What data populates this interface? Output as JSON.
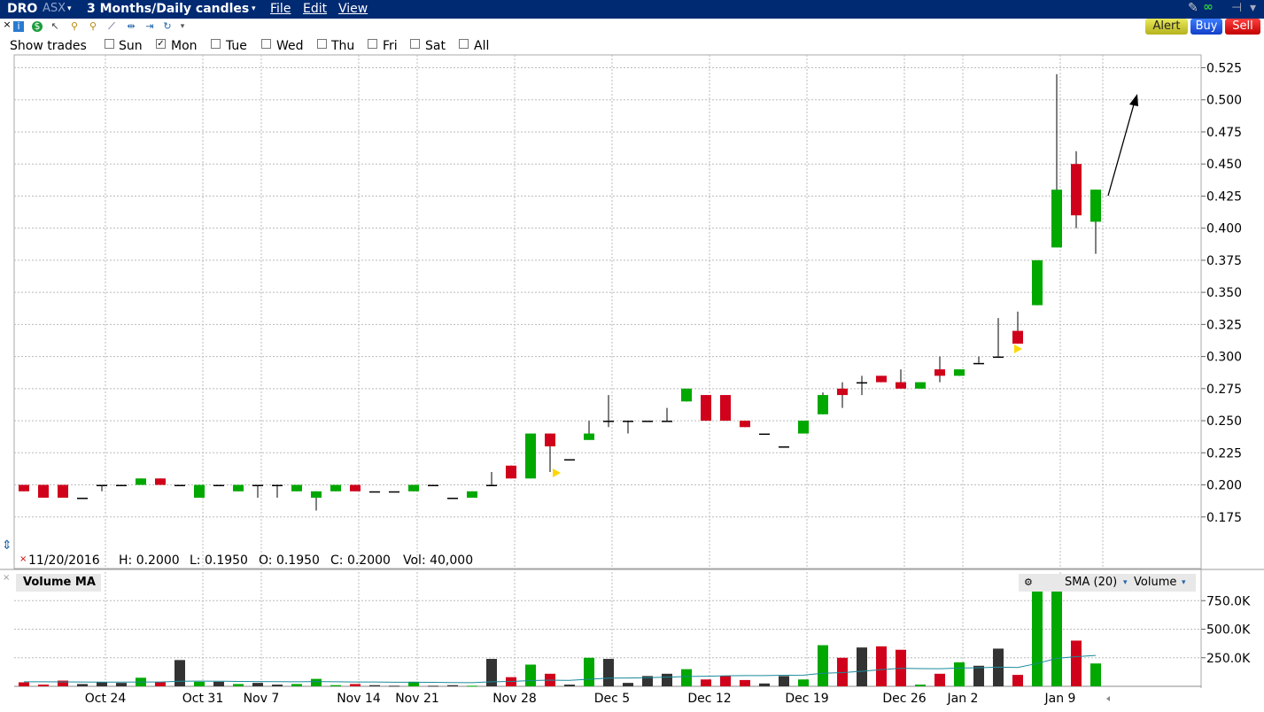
{
  "header": {
    "symbol": "DRO",
    "exchange": "ASX",
    "timeframe": "3 Months/Daily candles",
    "menu": [
      "File",
      "Edit",
      "View"
    ]
  },
  "buttons": {
    "alert": "Alert",
    "buy": "Buy",
    "sell": "Sell"
  },
  "colors": {
    "up": "#00a800",
    "down": "#d0021b",
    "neutral": "#333333",
    "sma": "#1a8a9a",
    "titlebar": "#002a72"
  },
  "show_trades": {
    "label": "Show trades",
    "days": [
      {
        "label": "Sun",
        "checked": false
      },
      {
        "label": "Mon",
        "checked": true
      },
      {
        "label": "Tue",
        "checked": false
      },
      {
        "label": "Wed",
        "checked": false
      },
      {
        "label": "Thu",
        "checked": false
      },
      {
        "label": "Fri",
        "checked": false
      },
      {
        "label": "Sat",
        "checked": false
      },
      {
        "label": "All",
        "checked": false
      }
    ]
  },
  "ohlc": {
    "date": "11/20/2016",
    "h": "H: 0.2000",
    "l": "L: 0.1950",
    "o": "O: 0.1950",
    "c": "C: 0.2000",
    "vol": "Vol: 40,000"
  },
  "volume_panel": {
    "label": "Volume MA",
    "sma": "SMA (20)",
    "volume": "Volume"
  },
  "chart_data": {
    "type": "candlestick",
    "ylim": [
      0.15,
      0.535
    ],
    "yticks": [
      "0.175",
      "0.200",
      "0.225",
      "0.250",
      "0.275",
      "0.300",
      "0.325",
      "0.350",
      "0.375",
      "0.400",
      "0.425",
      "0.450",
      "0.475",
      "0.500",
      "0.525"
    ],
    "yticks_num": [
      0.175,
      0.2,
      0.225,
      0.25,
      0.275,
      0.3,
      0.325,
      0.35,
      0.375,
      0.4,
      0.425,
      0.45,
      0.475,
      0.5,
      0.525
    ],
    "xticks": [
      "Oct 24",
      "Oct 31",
      "Nov 7",
      "Nov 14",
      "Nov 21",
      "Nov 28",
      "Dec 5",
      "Dec 12",
      "Dec 19",
      "Dec 26",
      "Jan 2",
      "Jan 9"
    ],
    "xtick_index": [
      4,
      9,
      12,
      17,
      20,
      25,
      30,
      35,
      40,
      45,
      48,
      53
    ],
    "candles": [
      {
        "o": 0.2,
        "h": 0.2,
        "l": 0.195,
        "c": 0.195
      },
      {
        "o": 0.2,
        "h": 0.2,
        "l": 0.19,
        "c": 0.19
      },
      {
        "o": 0.2,
        "h": 0.2,
        "l": 0.19,
        "c": 0.19
      },
      {
        "o": 0.19,
        "h": 0.19,
        "l": 0.19,
        "c": 0.19
      },
      {
        "o": 0.2,
        "h": 0.2,
        "l": 0.195,
        "c": 0.2
      },
      {
        "o": 0.2,
        "h": 0.2,
        "l": 0.2,
        "c": 0.2
      },
      {
        "o": 0.2,
        "h": 0.205,
        "l": 0.2,
        "c": 0.205
      },
      {
        "o": 0.205,
        "h": 0.205,
        "l": 0.2,
        "c": 0.2
      },
      {
        "o": 0.2,
        "h": 0.2,
        "l": 0.2,
        "c": 0.2
      },
      {
        "o": 0.19,
        "h": 0.2,
        "l": 0.19,
        "c": 0.2
      },
      {
        "o": 0.2,
        "h": 0.2,
        "l": 0.2,
        "c": 0.2
      },
      {
        "o": 0.195,
        "h": 0.2,
        "l": 0.195,
        "c": 0.2
      },
      {
        "o": 0.2,
        "h": 0.2,
        "l": 0.19,
        "c": 0.2
      },
      {
        "o": 0.2,
        "h": 0.2,
        "l": 0.19,
        "c": 0.2
      },
      {
        "o": 0.195,
        "h": 0.2,
        "l": 0.195,
        "c": 0.2
      },
      {
        "o": 0.19,
        "h": 0.195,
        "l": 0.18,
        "c": 0.195
      },
      {
        "o": 0.195,
        "h": 0.2,
        "l": 0.195,
        "c": 0.2
      },
      {
        "o": 0.2,
        "h": 0.2,
        "l": 0.195,
        "c": 0.195
      },
      {
        "o": 0.195,
        "h": 0.195,
        "l": 0.195,
        "c": 0.195
      },
      {
        "o": 0.195,
        "h": 0.195,
        "l": 0.195,
        "c": 0.195
      },
      {
        "o": 0.195,
        "h": 0.2,
        "l": 0.195,
        "c": 0.2
      },
      {
        "o": 0.2,
        "h": 0.2,
        "l": 0.2,
        "c": 0.2
      },
      {
        "o": 0.19,
        "h": 0.19,
        "l": 0.19,
        "c": 0.19
      },
      {
        "o": 0.19,
        "h": 0.195,
        "l": 0.19,
        "c": 0.195
      },
      {
        "o": 0.2,
        "h": 0.21,
        "l": 0.2,
        "c": 0.2
      },
      {
        "o": 0.215,
        "h": 0.215,
        "l": 0.205,
        "c": 0.205
      },
      {
        "o": 0.205,
        "h": 0.24,
        "l": 0.205,
        "c": 0.24
      },
      {
        "o": 0.24,
        "h": 0.24,
        "l": 0.21,
        "c": 0.23
      },
      {
        "o": 0.22,
        "h": 0.22,
        "l": 0.22,
        "c": 0.22
      },
      {
        "o": 0.235,
        "h": 0.25,
        "l": 0.235,
        "c": 0.24
      },
      {
        "o": 0.25,
        "h": 0.27,
        "l": 0.245,
        "c": 0.25
      },
      {
        "o": 0.25,
        "h": 0.25,
        "l": 0.24,
        "c": 0.25
      },
      {
        "o": 0.25,
        "h": 0.25,
        "l": 0.25,
        "c": 0.25
      },
      {
        "o": 0.25,
        "h": 0.26,
        "l": 0.25,
        "c": 0.25
      },
      {
        "o": 0.265,
        "h": 0.275,
        "l": 0.265,
        "c": 0.275
      },
      {
        "o": 0.27,
        "h": 0.27,
        "l": 0.25,
        "c": 0.25
      },
      {
        "o": 0.27,
        "h": 0.27,
        "l": 0.25,
        "c": 0.25
      },
      {
        "o": 0.25,
        "h": 0.25,
        "l": 0.245,
        "c": 0.245
      },
      {
        "o": 0.24,
        "h": 0.24,
        "l": 0.24,
        "c": 0.24
      },
      {
        "o": 0.23,
        "h": 0.23,
        "l": 0.23,
        "c": 0.23
      },
      {
        "o": 0.24,
        "h": 0.25,
        "l": 0.24,
        "c": 0.25
      },
      {
        "o": 0.255,
        "h": 0.272,
        "l": 0.255,
        "c": 0.27
      },
      {
        "o": 0.275,
        "h": 0.28,
        "l": 0.26,
        "c": 0.27
      },
      {
        "o": 0.28,
        "h": 0.285,
        "l": 0.27,
        "c": 0.28
      },
      {
        "o": 0.285,
        "h": 0.285,
        "l": 0.28,
        "c": 0.28
      },
      {
        "o": 0.28,
        "h": 0.29,
        "l": 0.275,
        "c": 0.275
      },
      {
        "o": 0.275,
        "h": 0.28,
        "l": 0.275,
        "c": 0.28
      },
      {
        "o": 0.29,
        "h": 0.3,
        "l": 0.28,
        "c": 0.285
      },
      {
        "o": 0.285,
        "h": 0.29,
        "l": 0.285,
        "c": 0.29
      },
      {
        "o": 0.295,
        "h": 0.3,
        "l": 0.295,
        "c": 0.295
      },
      {
        "o": 0.3,
        "h": 0.33,
        "l": 0.3,
        "c": 0.3
      },
      {
        "o": 0.32,
        "h": 0.335,
        "l": 0.31,
        "c": 0.31
      },
      {
        "o": 0.34,
        "h": 0.375,
        "l": 0.34,
        "c": 0.375
      },
      {
        "o": 0.385,
        "h": 0.52,
        "l": 0.385,
        "c": 0.43
      },
      {
        "o": 0.45,
        "h": 0.46,
        "l": 0.4,
        "c": 0.41
      },
      {
        "o": 0.405,
        "h": 0.43,
        "l": 0.38,
        "c": 0.43
      }
    ],
    "volume_ylim": [
      0,
      1000000
    ],
    "volume_yticks": [
      "250.0K",
      "500.0K",
      "750.0K"
    ],
    "volume_yticks_num": [
      250000,
      500000,
      750000
    ],
    "volume": [
      35000,
      15000,
      50000,
      20000,
      35000,
      30000,
      75000,
      35000,
      230000,
      40000,
      40000,
      20000,
      30000,
      15000,
      20000,
      65000,
      10000,
      20000,
      10000,
      5000,
      40000,
      5000,
      10000,
      5000,
      240000,
      80000,
      190000,
      110000,
      15000,
      250000,
      240000,
      30000,
      90000,
      110000,
      150000,
      60000,
      90000,
      55000,
      25000,
      90000,
      60000,
      360000,
      250000,
      340000,
      350000,
      320000,
      15000,
      110000,
      210000,
      180000,
      330000,
      100000,
      950000,
      980000,
      400000,
      200000
    ],
    "sma": [
      40000,
      40000,
      39000,
      38000,
      37000,
      37000,
      38000,
      38000,
      45000,
      46000,
      45000,
      43000,
      42000,
      41000,
      40000,
      42000,
      40000,
      38000,
      38000,
      36000,
      36000,
      35000,
      33000,
      32000,
      40000,
      43000,
      50000,
      54000,
      52000,
      62000,
      72000,
      73000,
      76000,
      80000,
      86000,
      88000,
      92000,
      94000,
      94000,
      97000,
      98000,
      114000,
      120000,
      132000,
      146000,
      158000,
      155000,
      154000,
      160000,
      163000,
      168000,
      165000,
      200000,
      245000,
      260000,
      270000
    ]
  }
}
